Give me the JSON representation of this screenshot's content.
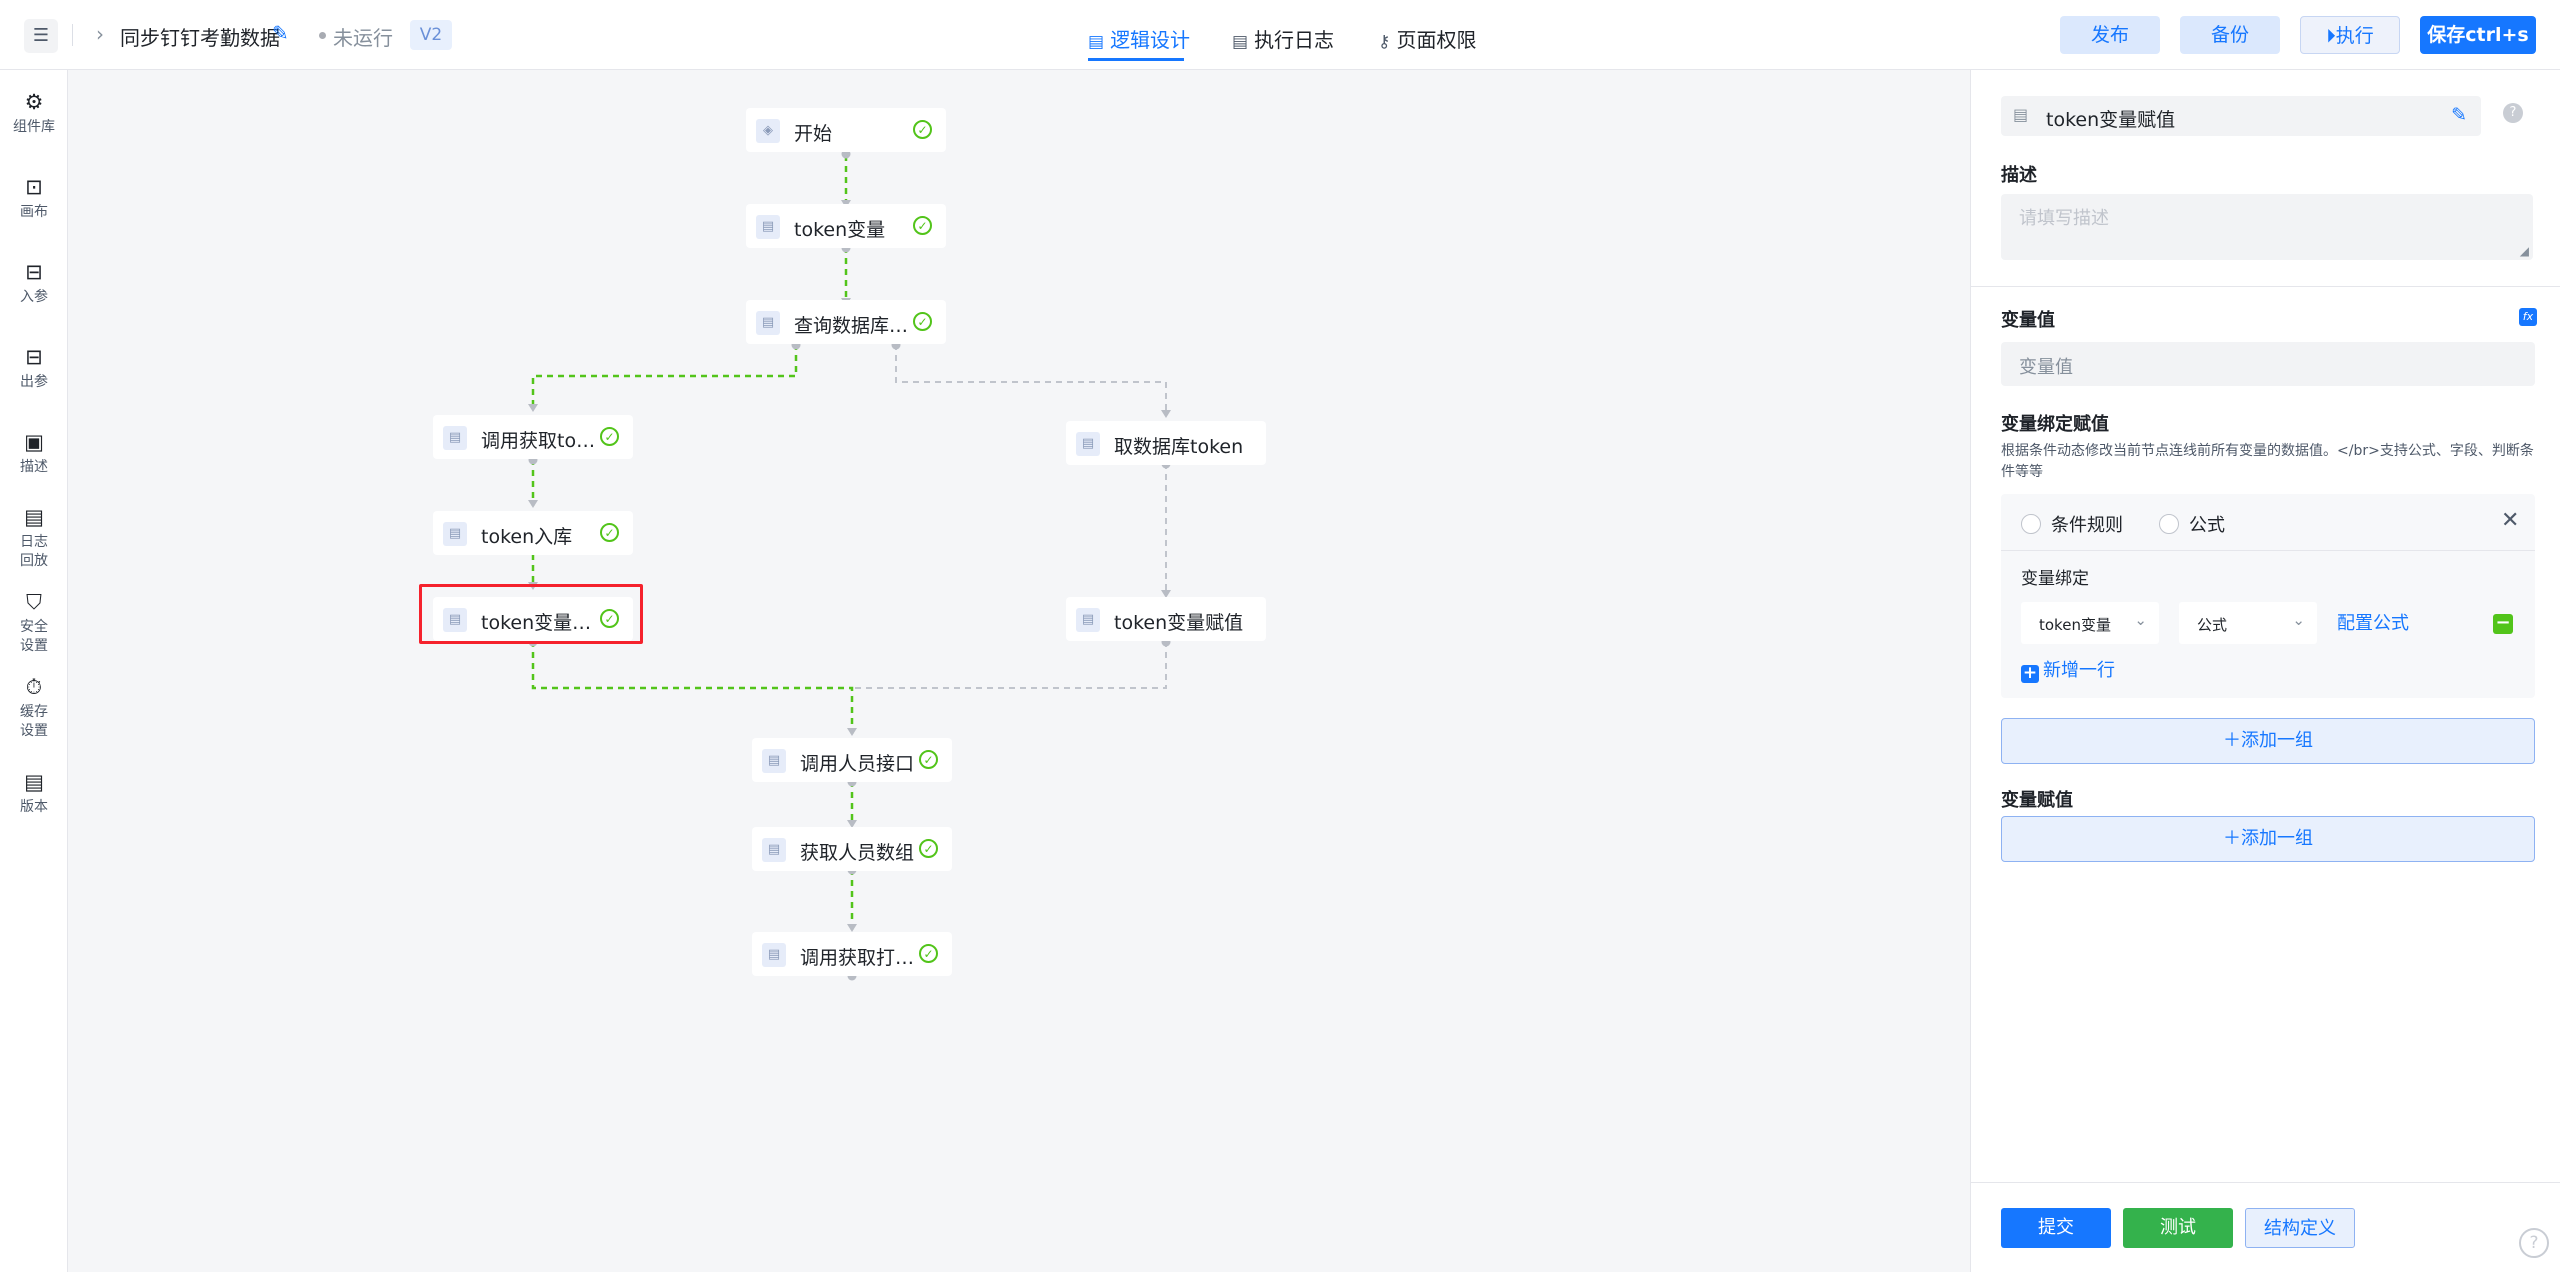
{
  "header": {
    "menu_icon": "list-icon",
    "app_title": "同步钉钉考勤数据",
    "status_text": "未运行",
    "version_badge": "V2",
    "tabs": [
      {
        "label": "逻辑设计",
        "icon": "design-doc-icon",
        "active": true
      },
      {
        "label": "执行日志",
        "icon": "log-doc-icon",
        "active": false
      },
      {
        "label": "页面权限",
        "icon": "key-icon",
        "active": false
      }
    ],
    "buttons": {
      "publish": "发布",
      "backup": "备份",
      "execute": "执行",
      "save": "保存ctrl+s"
    }
  },
  "sidebar": {
    "items": [
      {
        "label": "组件库",
        "icon": "puzzle-icon"
      },
      {
        "label": "画布",
        "icon": "canvas-icon"
      },
      {
        "label": "入参",
        "icon": "input-params-icon"
      },
      {
        "label": "出参",
        "icon": "output-params-icon"
      },
      {
        "label": "描述",
        "icon": "description-icon"
      },
      {
        "label": "日志\n回放",
        "icon": "log-replay-icon"
      },
      {
        "label": "安全\n设置",
        "icon": "shield-icon"
      },
      {
        "label": "缓存\n设置",
        "icon": "timer-icon"
      },
      {
        "label": "版本",
        "icon": "version-icon"
      }
    ]
  },
  "flow": {
    "nodes": [
      {
        "label": "开始",
        "status": "success",
        "icon": "layers-icon"
      },
      {
        "label": "token变量",
        "status": "success",
        "icon": "node-icon"
      },
      {
        "label": "查询数据库to...",
        "status": "success",
        "icon": "node-icon"
      },
      {
        "label": "调用获取token",
        "status": "success",
        "icon": "node-icon"
      },
      {
        "label": "取数据库token",
        "status": "",
        "icon": "node-icon"
      },
      {
        "label": "token入库",
        "status": "success",
        "icon": "node-icon"
      },
      {
        "label": "token变量赋值",
        "status": "success",
        "icon": "node-icon",
        "selected": true
      },
      {
        "label": "token变量赋值",
        "status": "",
        "icon": "node-icon"
      },
      {
        "label": "调用人员接口",
        "status": "success",
        "icon": "node-icon"
      },
      {
        "label": "获取人员数组",
        "status": "success",
        "icon": "node-icon"
      },
      {
        "label": "调用获取打卡...",
        "status": "success",
        "icon": "node-icon"
      }
    ],
    "colors": {
      "active_edge": "#52c41a",
      "inactive_edge": "#c0c4cc",
      "selected_border": "#f5222d"
    }
  },
  "panel": {
    "node_name": "token变量赋值",
    "description_label": "描述",
    "description_placeholder": "请填写描述",
    "variable_value_label": "变量值",
    "variable_value_placeholder": "变量值",
    "binding_title": "变量绑定赋值",
    "binding_desc": "根据条件动态修改当前节点连线前所有变量的数据值。</br>支持公式、字段、判断条件等等",
    "radio_options": [
      "条件规则",
      "公式"
    ],
    "binding_sub_label": "变量绑定",
    "binding_variable": "token变量",
    "binding_type": "公式",
    "config_formula_link": "配置公式",
    "add_row": "新增一行",
    "add_group": "添加一组",
    "assign_title": "变量赋值",
    "footer_buttons": {
      "submit": "提交",
      "test": "测试",
      "structure": "结构定义"
    }
  },
  "accent_color": "#1677ff"
}
